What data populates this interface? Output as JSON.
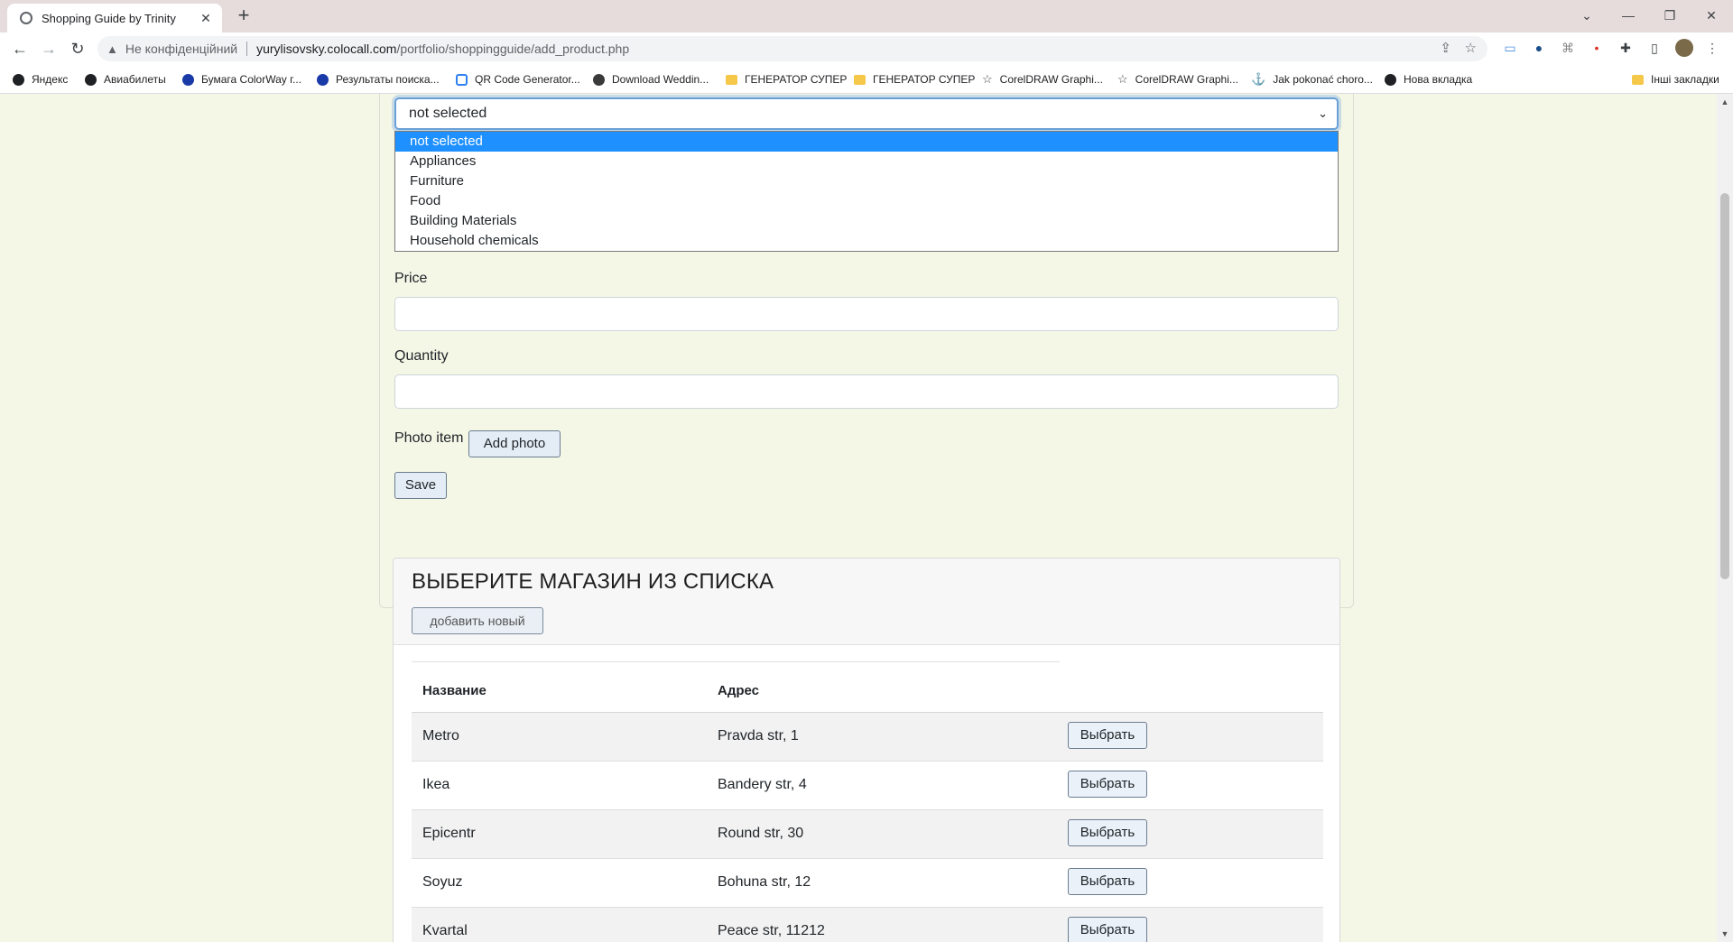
{
  "browser": {
    "tab_title": "Shopping Guide by Trinity",
    "tab_close": "✕",
    "new_tab": "+",
    "security_label": "Не конфіденційний",
    "url_host": "yurylisovsky.colocall.com",
    "url_path": "/portfolio/shoppingguide/add_product.php",
    "window_controls": {
      "minimize": "—",
      "restore": "❐",
      "close": "✕",
      "tabs_menu": "⌄"
    },
    "bookmarks": [
      {
        "label": "Яндекс",
        "icon": "globe-icon"
      },
      {
        "label": "Авиабилеты",
        "icon": "globe-icon"
      },
      {
        "label": "Бумага ColorWay г...",
        "icon": "c-logo-icon"
      },
      {
        "label": "Результаты поиска...",
        "icon": "c-logo-icon"
      },
      {
        "label": "QR Code Generator...",
        "icon": "qr-icon"
      },
      {
        "label": "Download Weddin...",
        "icon": "download-site-icon"
      },
      {
        "label": "ГЕНЕРАТОР СУПЕР",
        "icon": "folder-icon"
      },
      {
        "label": "ГЕНЕРАТОР СУПЕР",
        "icon": "folder-icon"
      },
      {
        "label": "CorelDRAW Graphi...",
        "icon": "star-icon"
      },
      {
        "label": "CorelDRAW Graphi...",
        "icon": "star-icon"
      },
      {
        "label": "Jak pokonać choro...",
        "icon": "anchor-icon"
      },
      {
        "label": "Нова вкладка",
        "icon": "globe-icon"
      }
    ],
    "other_bookmarks": "Інші закладки"
  },
  "form": {
    "category_select": {
      "selected": "not selected",
      "options": [
        "not selected",
        "Appliances",
        "Furniture",
        "Food",
        "Building Materials",
        "Household chemicals"
      ]
    },
    "price_label": "Price",
    "quantity_label": "Quantity",
    "photo_label": "Photo item",
    "add_photo_button": "Add photo",
    "save_button": "Save"
  },
  "stores": {
    "title": "ВЫБЕРИТЕ МАГАЗИН ИЗ СПИСКА",
    "add_new_button": "добавить новый",
    "columns": [
      "Название",
      "Адрес"
    ],
    "select_label": "Выбрать",
    "rows": [
      {
        "name": "Metro",
        "address": "Pravda str, 1"
      },
      {
        "name": "Ikea",
        "address": "Bandery str, 4"
      },
      {
        "name": "Epicentr",
        "address": "Round str, 30"
      },
      {
        "name": "Soyuz",
        "address": "Bohuna str, 12"
      },
      {
        "name": "Kvartal",
        "address": "Peace str, 11212"
      }
    ]
  }
}
